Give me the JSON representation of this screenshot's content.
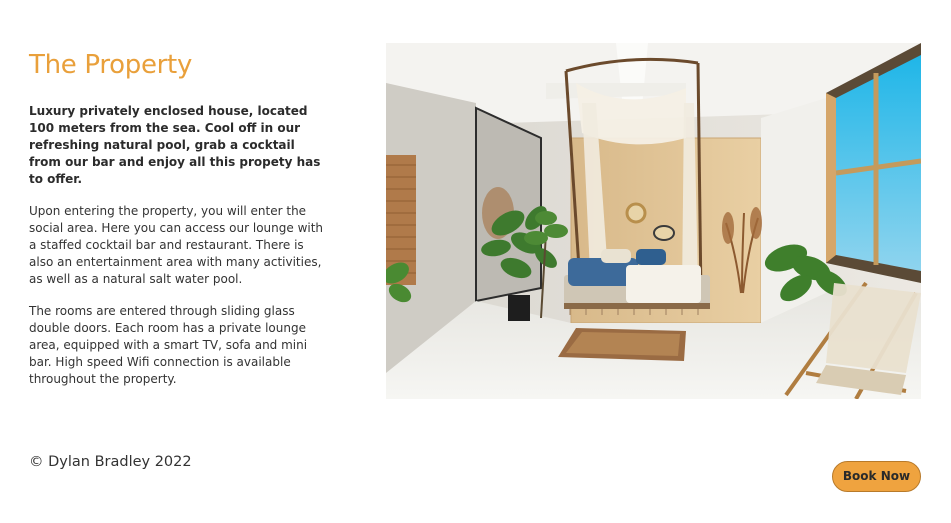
{
  "property": {
    "title": "The Property",
    "lead": "Luxury privately enclosed house, located 100 meters from the sea. Cool off in our refreshing natural pool, grab a cocktail from our bar and enjoy all this propety has to offer.",
    "paragraph_1": "Upon entering the property, you will enter the social area. Here you can access our lounge with a staffed cocktail bar and restaurant. There is also an entertainment area with many activities, as well as a natural salt water pool.",
    "paragraph_2": "The rooms are entered through sliding glass double doors. Each room has a private lounge area, equipped with a smart TV, sofa and mini bar. High speed Wifi connection is available throughout the property."
  },
  "footer": {
    "copyright": "© Dylan Bradley 2022",
    "book_label": "Book Now"
  },
  "colors": {
    "accent": "#e9a03b",
    "button": "#efa33f",
    "text": "#333333"
  }
}
